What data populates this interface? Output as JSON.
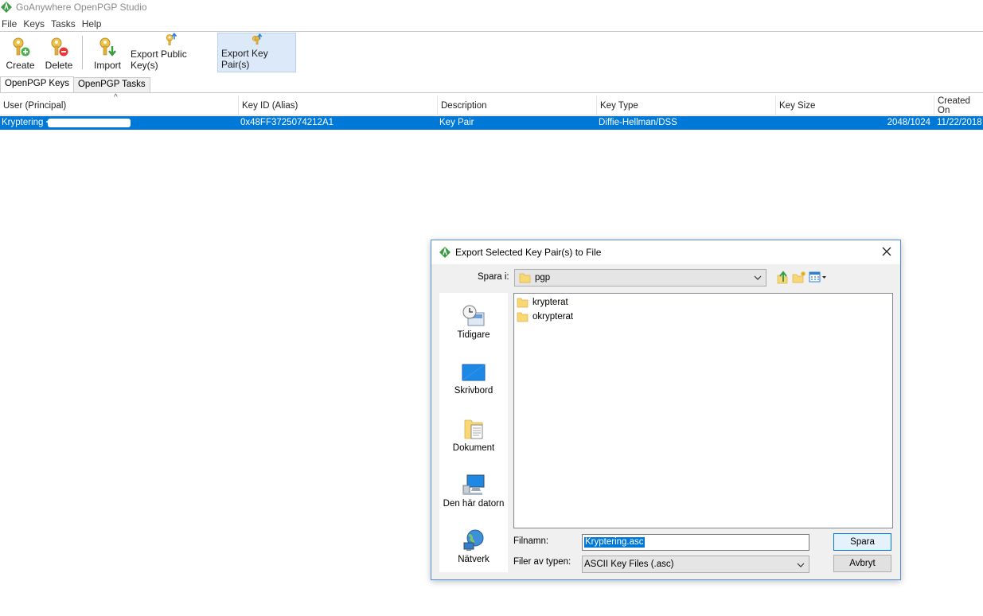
{
  "window": {
    "title": "GoAnywhere OpenPGP Studio"
  },
  "menu": [
    "File",
    "Keys",
    "Tasks",
    "Help"
  ],
  "toolbar": {
    "create": "Create",
    "delete": "Delete",
    "import": "Import",
    "export_public": "Export Public Key(s)",
    "export_pair": "Export Key Pair(s)"
  },
  "tabs": [
    "OpenPGP Keys",
    "OpenPGP Tasks"
  ],
  "table": {
    "columns": [
      "User (Principal)",
      "Key ID (Alias)",
      "Description",
      "Key Type",
      "Key Size",
      "Created On"
    ],
    "rows": [
      {
        "user": "Kryptering <",
        "key_id": "0x48FF3725074212A1",
        "description": "Key Pair",
        "key_type": "Diffie-Hellman/DSS",
        "key_size": "2048/1024",
        "created": "11/22/2018"
      }
    ]
  },
  "dialog": {
    "title": "Export Selected Key Pair(s) to File",
    "look_in_label": "Spara i:",
    "look_in_value": "pgp",
    "places": [
      "Tidigare",
      "Skrivbord",
      "Dokument",
      "Den här datorn",
      "Nätverk"
    ],
    "files": [
      "krypterat",
      "okrypterat"
    ],
    "filename_label": "Filnamn:",
    "filename_value": "Kryptering.asc",
    "filetype_label": "Filer av typen:",
    "filetype_value": "ASCII Key Files (.asc)",
    "save_button": "Spara",
    "cancel_button": "Avbryt"
  },
  "colors": {
    "selection": "#0078d7",
    "accent_border": "#4d8fd6",
    "folder": "#f8d775"
  }
}
